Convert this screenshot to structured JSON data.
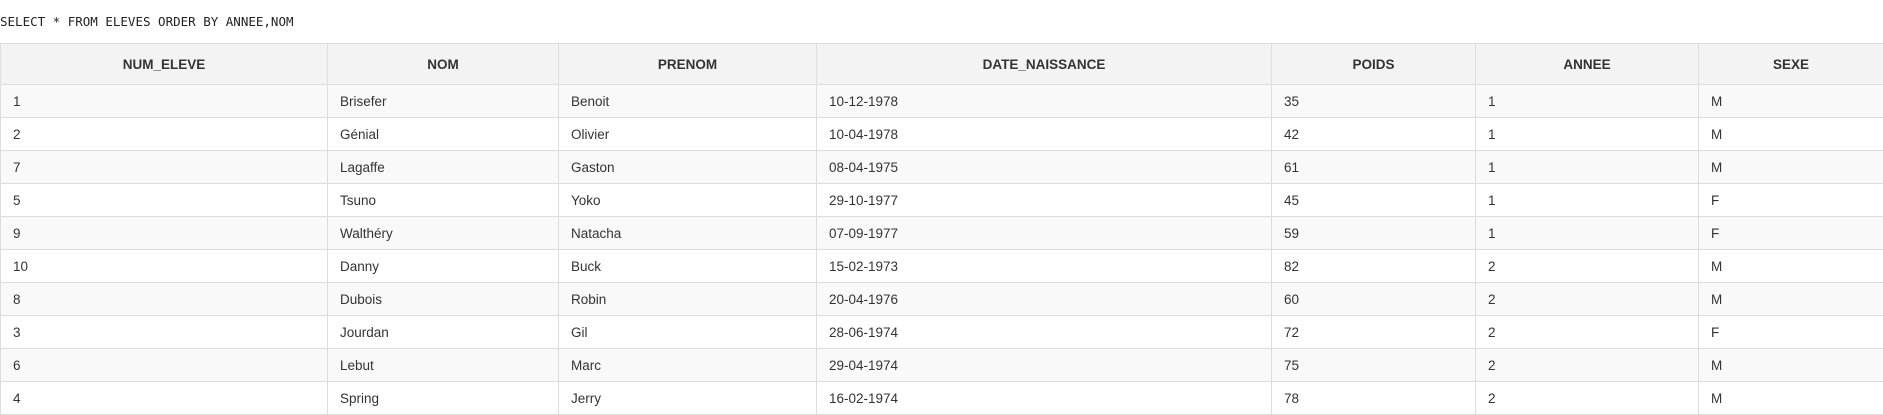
{
  "query": "SELECT * FROM ELEVES ORDER BY ANNEE,NOM",
  "table": {
    "columns": [
      "NUM_ELEVE",
      "NOM",
      "PRENOM",
      "DATE_NAISSANCE",
      "POIDS",
      "ANNEE",
      "SEXE"
    ],
    "rows": [
      [
        "1",
        "Brisefer",
        "Benoit",
        "10-12-1978",
        "35",
        "1",
        "M"
      ],
      [
        "2",
        "Génial",
        "Olivier",
        "10-04-1978",
        "42",
        "1",
        "M"
      ],
      [
        "7",
        "Lagaffe",
        "Gaston",
        "08-04-1975",
        "61",
        "1",
        "M"
      ],
      [
        "5",
        "Tsuno",
        "Yoko",
        "29-10-1977",
        "45",
        "1",
        "F"
      ],
      [
        "9",
        "Walthéry",
        "Natacha",
        "07-09-1977",
        "59",
        "1",
        "F"
      ],
      [
        "10",
        "Danny",
        "Buck",
        "15-02-1973",
        "82",
        "2",
        "M"
      ],
      [
        "8",
        "Dubois",
        "Robin",
        "20-04-1976",
        "60",
        "2",
        "M"
      ],
      [
        "3",
        "Jourdan",
        "Gil",
        "28-06-1974",
        "72",
        "2",
        "F"
      ],
      [
        "6",
        "Lebut",
        "Marc",
        "29-04-1974",
        "75",
        "2",
        "M"
      ],
      [
        "4",
        "Spring",
        "Jerry",
        "16-02-1974",
        "78",
        "2",
        "M"
      ]
    ]
  }
}
